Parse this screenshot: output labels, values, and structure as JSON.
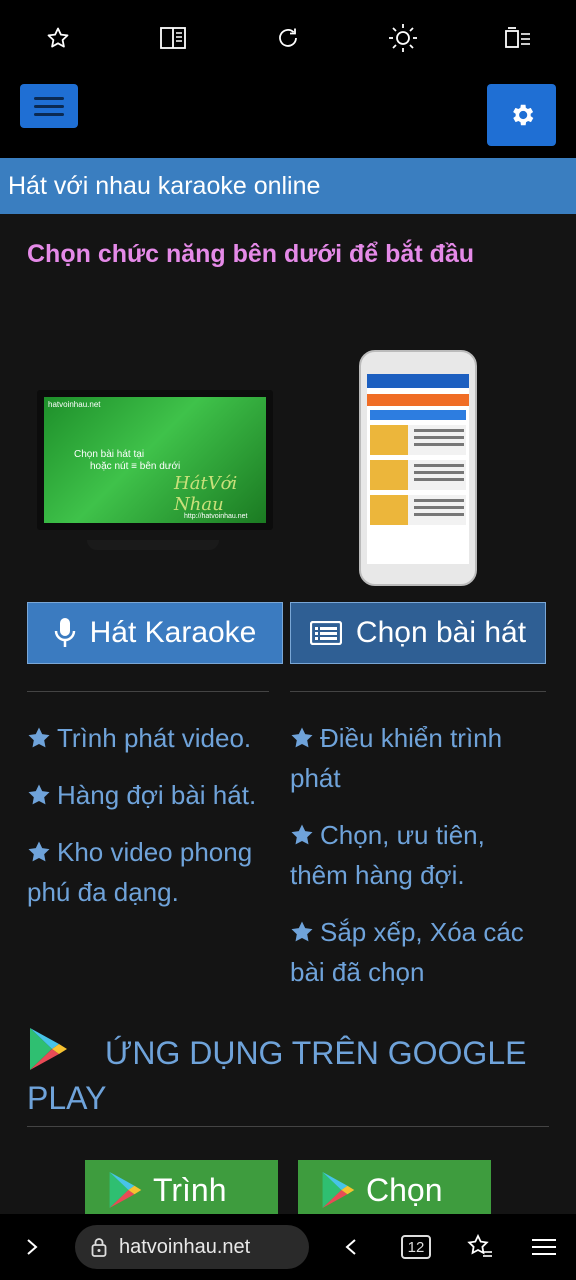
{
  "browser_toolbar": {
    "icons": [
      "star-icon",
      "reader-mode-icon",
      "reload-icon",
      "brightness-icon",
      "page-menu-icon"
    ]
  },
  "nav": {
    "menu_icon": "hamburger-icon",
    "settings_icon": "gear-icon"
  },
  "site_title": "Hát với nhau karaoke online",
  "subtitle": "Chọn chức năng bên dưới để bắt đầu",
  "tv_image": {
    "brand": "hatvoinhau.net",
    "line1": "Chọn bài hát tại",
    "line2": "hoặc nút ≡ bên dưới",
    "logo": "HátVới Nhau",
    "url": "http://hatvoinhau.net"
  },
  "buttons": {
    "karaoke_label": "Hát Karaoke",
    "chon_label": "Chọn bài hát"
  },
  "features_left": [
    "Trình phát video.",
    "Hàng đợi bài hát.",
    "Kho video phong phú đa dạng."
  ],
  "features_right": [
    "Điều khiển trình phát",
    "Chọn, ưu tiên, thêm hàng đợi.",
    "Sắp xếp, Xóa các bài đã chọn"
  ],
  "google_play_heading": "ỨNG DỤNG TRÊN GOOGLE PLAY",
  "gp_buttons": {
    "a_label": "Trình",
    "b_label": "Chọn"
  },
  "bottom_bar": {
    "url": "hatvoinhau.net",
    "tab_count": "12"
  },
  "colors": {
    "accent_blue": "#1f6fd4",
    "title_bar": "#3a7ec0",
    "subtitle_pink": "#e58ae8",
    "feature_text": "#6fa3da",
    "play_green": "#3e9c3e"
  }
}
